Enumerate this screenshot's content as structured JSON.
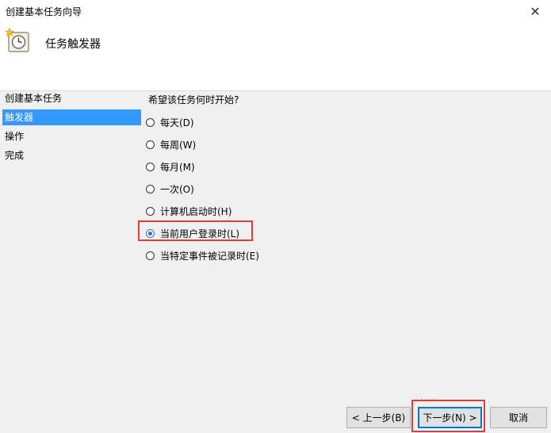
{
  "window": {
    "title": "创建基本任务向导",
    "close_glyph": "✕"
  },
  "header": {
    "title": "任务触发器",
    "icon": "clock-task-icon"
  },
  "sidebar": {
    "items": [
      {
        "label": "创建基本任务",
        "active": false
      },
      {
        "label": "触发器",
        "active": true
      },
      {
        "label": "操作",
        "active": false
      },
      {
        "label": "完成",
        "active": false
      }
    ]
  },
  "main": {
    "question": "希望该任务何时开始?",
    "options": [
      {
        "label": "每天(D)",
        "checked": false
      },
      {
        "label": "每周(W)",
        "checked": false
      },
      {
        "label": "每月(M)",
        "checked": false
      },
      {
        "label": "一次(O)",
        "checked": false
      },
      {
        "label": "计算机启动时(H)",
        "checked": false
      },
      {
        "label": "当前用户登录时(L)",
        "checked": true
      },
      {
        "label": "当特定事件被记录时(E)",
        "checked": false
      }
    ]
  },
  "buttons": {
    "back_label": "< 上一步(B)",
    "next_label": "下一步(N) >",
    "cancel_label": "取消"
  },
  "colors": {
    "accent": "#3399ff",
    "highlight": "#e03c3c",
    "focus": "#0078d7"
  }
}
